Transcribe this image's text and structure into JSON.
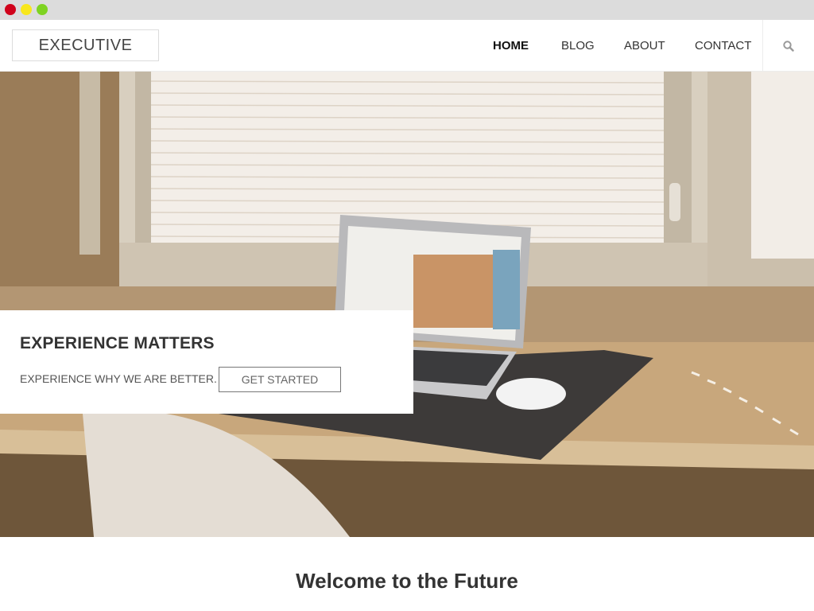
{
  "window": {
    "controls": [
      "close",
      "minimize",
      "maximize"
    ]
  },
  "header": {
    "logo": "EXECUTIVE",
    "nav": [
      {
        "label": "HOME",
        "active": true
      },
      {
        "label": "BLOG",
        "active": false
      },
      {
        "label": "ABOUT",
        "active": false
      },
      {
        "label": "CONTACT",
        "active": false
      }
    ],
    "search_icon": "search-icon"
  },
  "hero": {
    "image": "desk-with-laptop-photo",
    "title": "EXPERIENCE MATTERS",
    "subtitle": "EXPERIENCE WHY WE ARE BETTER.",
    "button": "GET STARTED"
  },
  "content": {
    "heading": "Welcome to the Future"
  },
  "colors": {
    "chrome_bar": "#dcdcdc",
    "close": "#d0021b",
    "minimize": "#f8e71c",
    "maximize": "#7ed321"
  }
}
